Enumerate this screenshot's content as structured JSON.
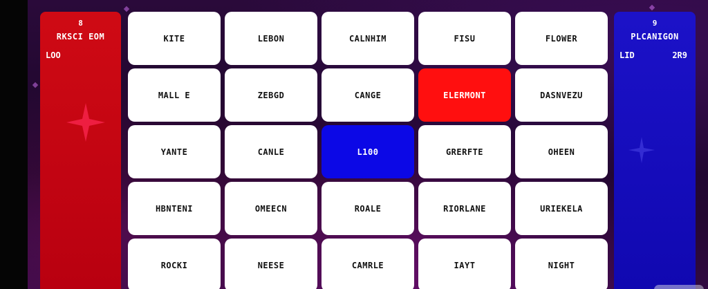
{
  "teams": {
    "red": {
      "count": "8",
      "name": "RKSCI EOM",
      "player": "LOO",
      "score": "",
      "color": "#cf0a14"
    },
    "blue": {
      "count": "9",
      "name": "PLCANIGON",
      "player": "LID",
      "score": "2R9",
      "color": "#1c12c8"
    }
  },
  "colors": {
    "card": "#ffffff",
    "card_red": "#ff0f0f",
    "card_blue": "#0c08e6",
    "background": "#2a0a3a"
  },
  "cards": [
    {
      "word": "KITE",
      "state": "neutral"
    },
    {
      "word": "LEBON",
      "state": "neutral"
    },
    {
      "word": "CALNHIM",
      "state": "neutral"
    },
    {
      "word": "FISU",
      "state": "neutral"
    },
    {
      "word": "FLOWER",
      "state": "neutral"
    },
    {
      "word": "MALL E",
      "state": "neutral"
    },
    {
      "word": "ZEBGD",
      "state": "neutral"
    },
    {
      "word": "CANGE",
      "state": "neutral"
    },
    {
      "word": "ELERMONT",
      "state": "red"
    },
    {
      "word": "DASNVEZU",
      "state": "neutral"
    },
    {
      "word": "YANTE",
      "state": "neutral"
    },
    {
      "word": "CANLE",
      "state": "neutral"
    },
    {
      "word": "L100",
      "state": "blue"
    },
    {
      "word": "GRERFTE",
      "state": "neutral"
    },
    {
      "word": "OHEEN",
      "state": "neutral"
    },
    {
      "word": "HBNTENI",
      "state": "neutral"
    },
    {
      "word": "OMEECN",
      "state": "neutral"
    },
    {
      "word": "ROALE",
      "state": "neutral"
    },
    {
      "word": "RIORLANE",
      "state": "neutral"
    },
    {
      "word": "URIEKELA",
      "state": "neutral"
    },
    {
      "word": "ROCKI",
      "state": "neutral"
    },
    {
      "word": "NEESE",
      "state": "neutral"
    },
    {
      "word": "CAMRLE",
      "state": "neutral"
    },
    {
      "word": "IAYT",
      "state": "neutral"
    },
    {
      "word": "NIGHT",
      "state": "neutral"
    }
  ]
}
